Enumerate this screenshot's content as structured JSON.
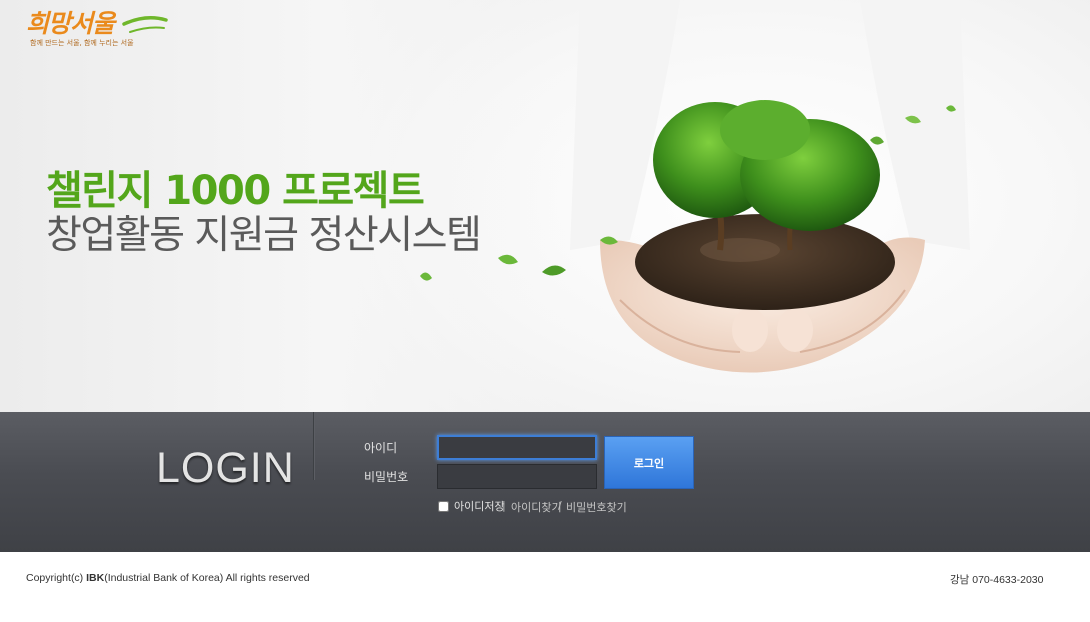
{
  "logo": {
    "main_text": "희망서울",
    "slogan": "함께 만드는 서울, 함께 누리는 서울"
  },
  "hero": {
    "headline_1": "챌린지 1000 프로젝트",
    "headline_2": "창업활동 지원금 정산시스템",
    "image": "hands-holding-tree-in-soil",
    "accent_color": "#53a61b"
  },
  "login": {
    "title": "LOGIN",
    "id_label": "아이디",
    "password_label": "비밀번호",
    "id_value": "",
    "password_value": "",
    "submit_label": "로그인",
    "save_id_label": "아이디저장",
    "save_id_checked": false,
    "separator_1": "|",
    "find_id_label": "아이디찾기",
    "separator_2": "/",
    "find_password_label": "비밀번호찾기",
    "button_color": "#3a84e0"
  },
  "footer": {
    "copyright_prefix": "Copyright(c) ",
    "copyright_brand": "IBK",
    "copyright_suffix": "(Industrial Bank of Korea) All rights reserved",
    "contact": "강남 070-4633-2030"
  }
}
